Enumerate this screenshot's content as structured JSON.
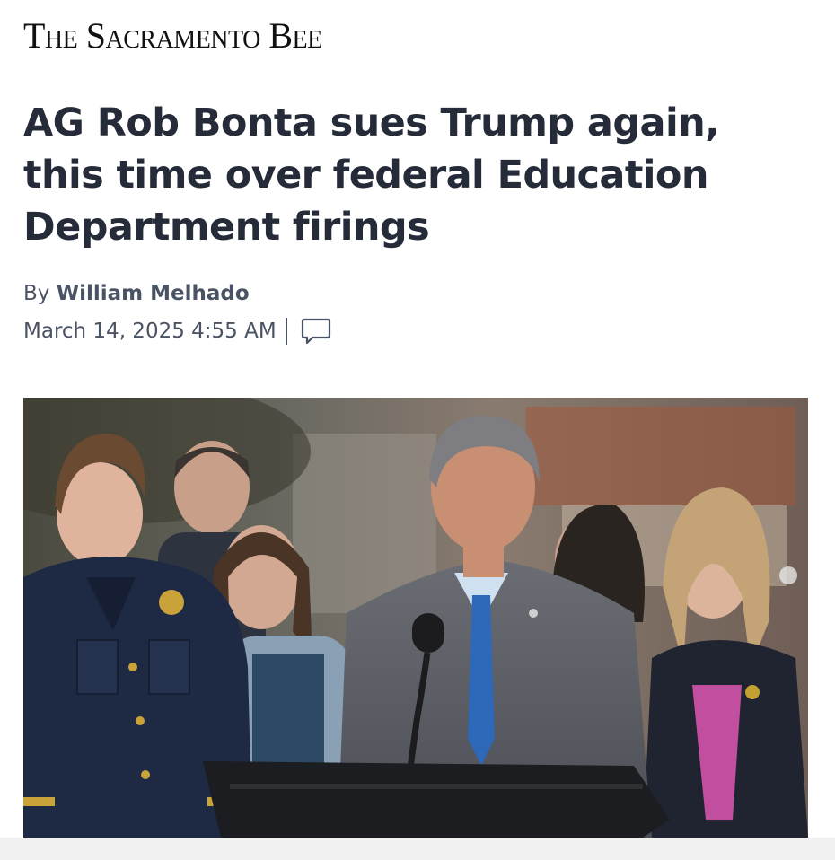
{
  "masthead": {
    "title": "The Sacramento Bee"
  },
  "article": {
    "headline": "AG Rob Bonta sues Trump again, this time over federal Education Department firings",
    "byline_prefix": "By",
    "author": "William Melhado",
    "timestamp": "March 14, 2025 4:55 AM"
  },
  "icons": {
    "comments": "comment-bubble-icon"
  },
  "photo": {
    "description_hidden": false
  }
}
